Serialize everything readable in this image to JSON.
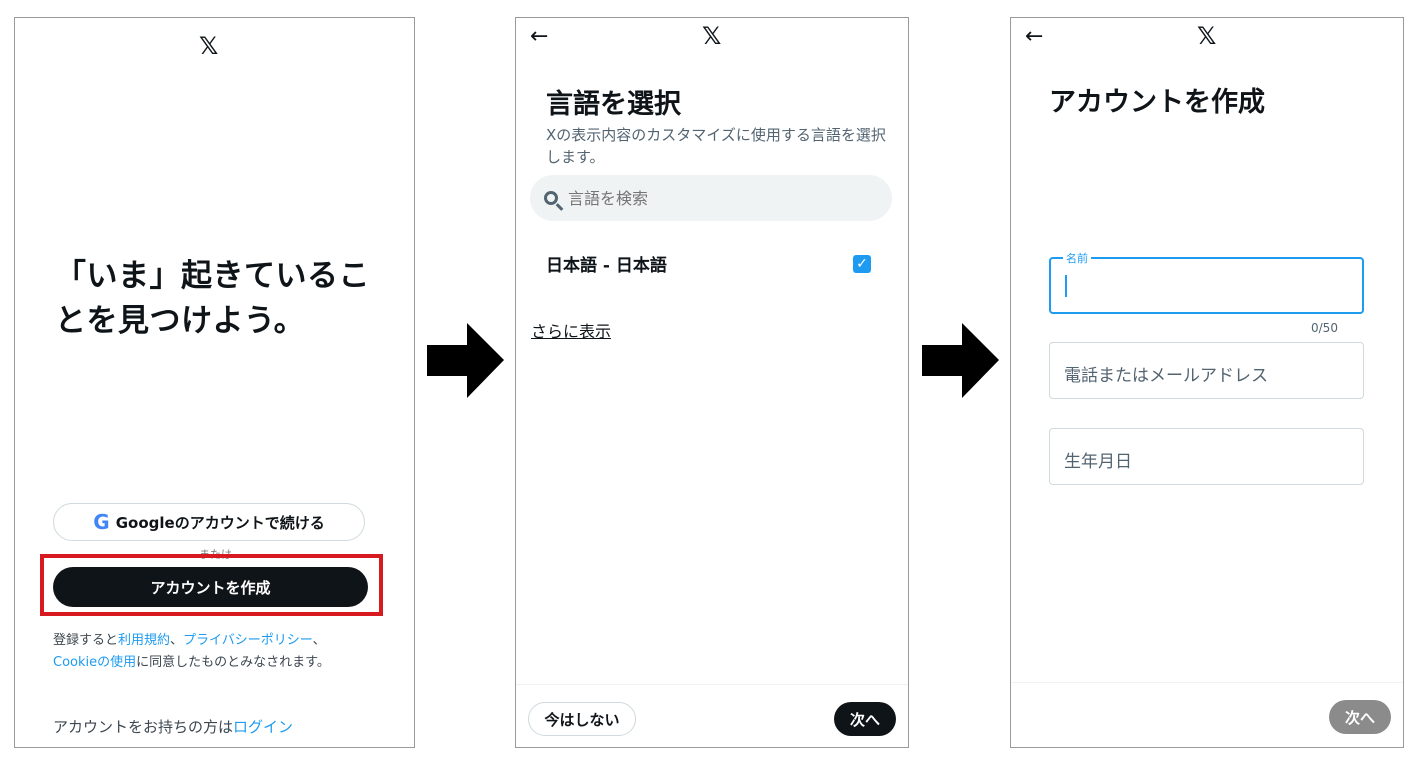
{
  "panel1": {
    "logo": "𝕏",
    "hero": "「いま」起きていることを見つけよう。",
    "google_icon": "G",
    "google_button": "Googleのアカウントで続ける",
    "or_label": "または",
    "create_button": "アカウントを作成",
    "legal_prefix": "登録すると",
    "legal_terms": "利用規約",
    "legal_sep": "、",
    "legal_privacy": "プライバシーポリシー",
    "legal_sep2": "、",
    "legal_cookie": "Cookieの使用",
    "legal_suffix": "に同意したものとみなされます。",
    "login_prefix": "アカウントをお持ちの方は",
    "login_link": "ログイン",
    "highlight_color": "#d71920"
  },
  "panel2": {
    "back": "←",
    "logo": "𝕏",
    "title": "言語を選択",
    "description": "Xの表示内容のカスタマイズに使用する言語を選択します。",
    "search_placeholder": "言語を検索",
    "language_item": "日本語 - 日本語",
    "language_checked": "✓",
    "show_more": "さらに表示",
    "skip_button": "今はしない",
    "next_button": "次へ"
  },
  "panel3": {
    "back": "←",
    "logo": "𝕏",
    "title": "アカウントを作成",
    "name_label": "名前",
    "name_counter": "0/50",
    "contact_placeholder": "電話またはメールアドレス",
    "birthday_placeholder": "生年月日",
    "next_button": "次へ"
  },
  "colors": {
    "accent": "#1d9bf0",
    "dark": "#0f1419",
    "disabled": "#8b8b8b"
  }
}
